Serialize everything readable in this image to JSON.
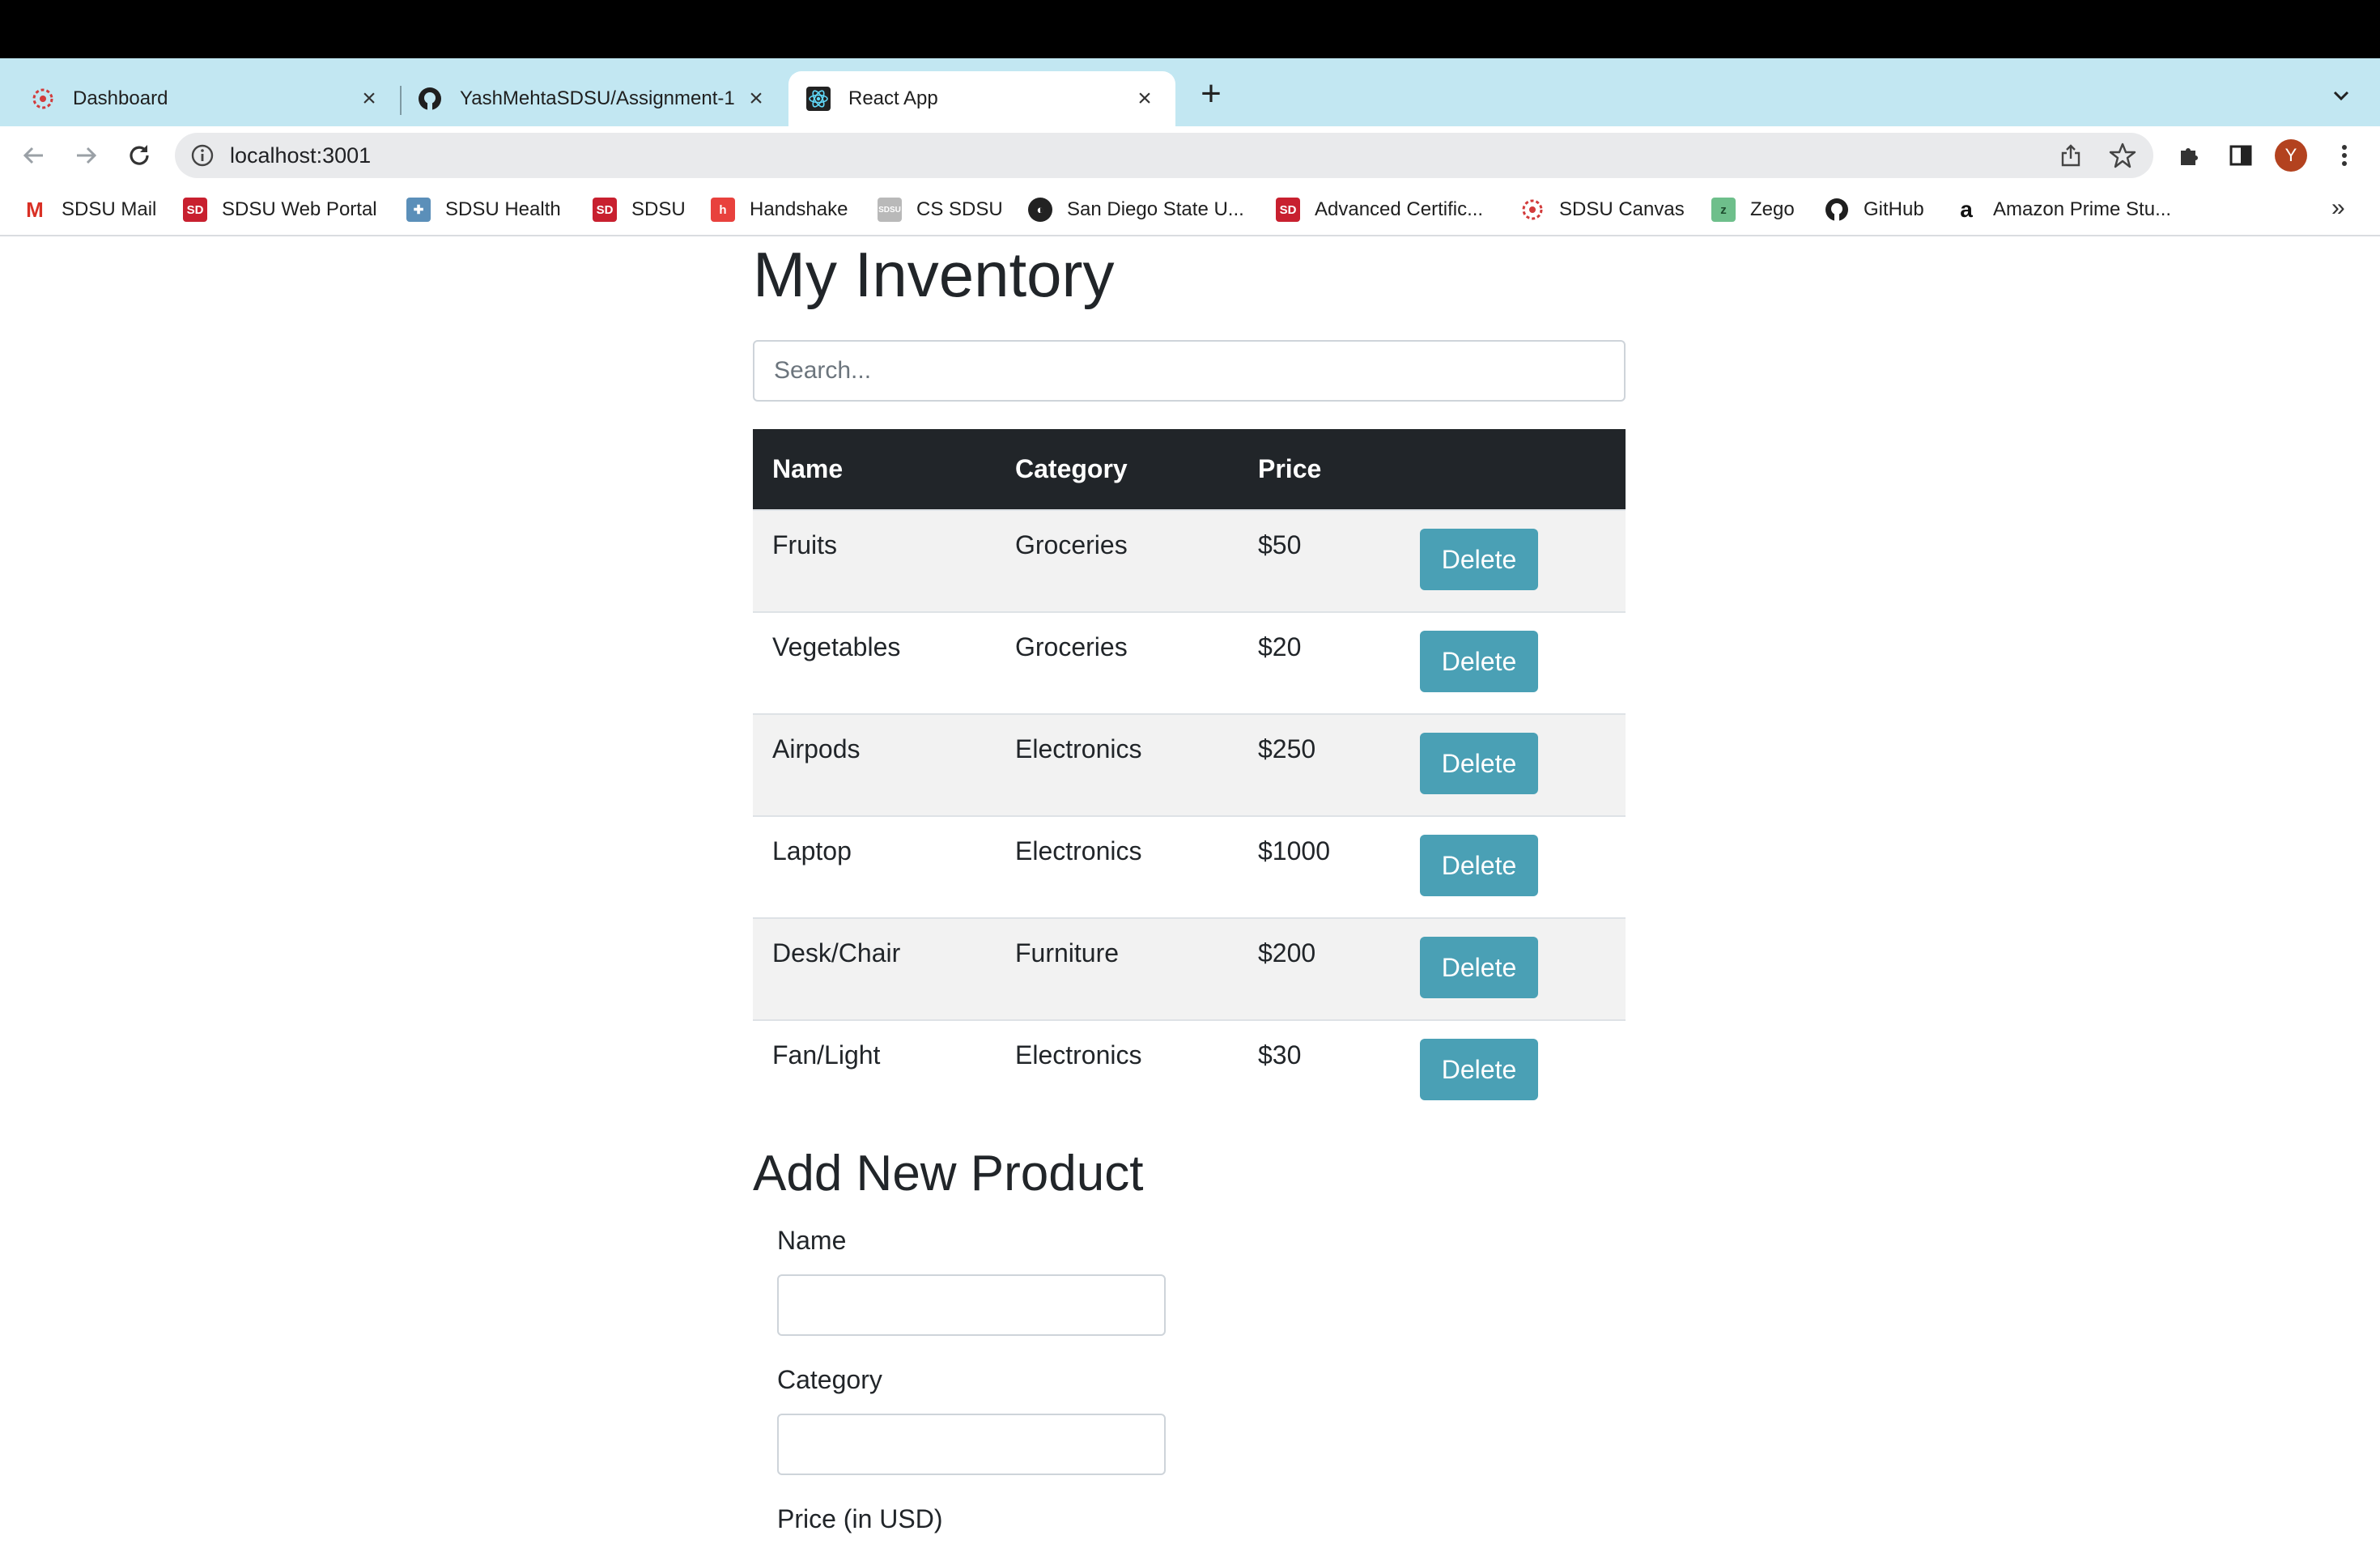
{
  "browser": {
    "tabs": [
      {
        "title": "Dashboard",
        "icon": "canvas-icon",
        "active": false
      },
      {
        "title": "YashMehtaSDSU/Assignment-1",
        "icon": "github-icon",
        "active": false
      },
      {
        "title": "React App",
        "icon": "react-icon",
        "active": true
      }
    ],
    "url": "localhost:3001",
    "avatar_letter": "Y",
    "bookmarks": [
      {
        "label": "SDSU Mail",
        "icon": "gmail-icon"
      },
      {
        "label": "SDSU Web Portal",
        "icon": "sd-icon"
      },
      {
        "label": "SDSU Health",
        "icon": "health-icon"
      },
      {
        "label": "SDSU",
        "icon": "sd-icon"
      },
      {
        "label": "Handshake",
        "icon": "handshake-icon"
      },
      {
        "label": "CS SDSU",
        "icon": "cs-icon"
      },
      {
        "label": "San Diego State U...",
        "icon": "globe-icon"
      },
      {
        "label": "Advanced Certific...",
        "icon": "sd-icon"
      },
      {
        "label": "SDSU Canvas",
        "icon": "canvas-icon"
      },
      {
        "label": "Zego",
        "icon": "zego-icon"
      },
      {
        "label": "GitHub",
        "icon": "github-icon"
      },
      {
        "label": "Amazon Prime Stu...",
        "icon": "amazon-icon"
      }
    ]
  },
  "page": {
    "title": "My Inventory",
    "search_placeholder": "Search...",
    "table": {
      "headers": [
        "Name",
        "Category",
        "Price",
        ""
      ],
      "rows": [
        {
          "name": "Fruits",
          "category": "Groceries",
          "price": "$50"
        },
        {
          "name": "Vegetables",
          "category": "Groceries",
          "price": "$20"
        },
        {
          "name": "Airpods",
          "category": "Electronics",
          "price": "$250"
        },
        {
          "name": "Laptop",
          "category": "Electronics",
          "price": "$1000"
        },
        {
          "name": "Desk/Chair",
          "category": "Furniture",
          "price": "$200"
        },
        {
          "name": "Fan/Light",
          "category": "Electronics",
          "price": "$30"
        }
      ],
      "delete_label": "Delete"
    },
    "add_form": {
      "title": "Add New Product",
      "name_label": "Name",
      "category_label": "Category",
      "price_label": "Price (in USD)"
    }
  },
  "colors": {
    "tabstrip": "#c2e7f2",
    "table_header": "#212529",
    "delete_button": "#4aa0b5",
    "avatar": "#b3421f"
  }
}
